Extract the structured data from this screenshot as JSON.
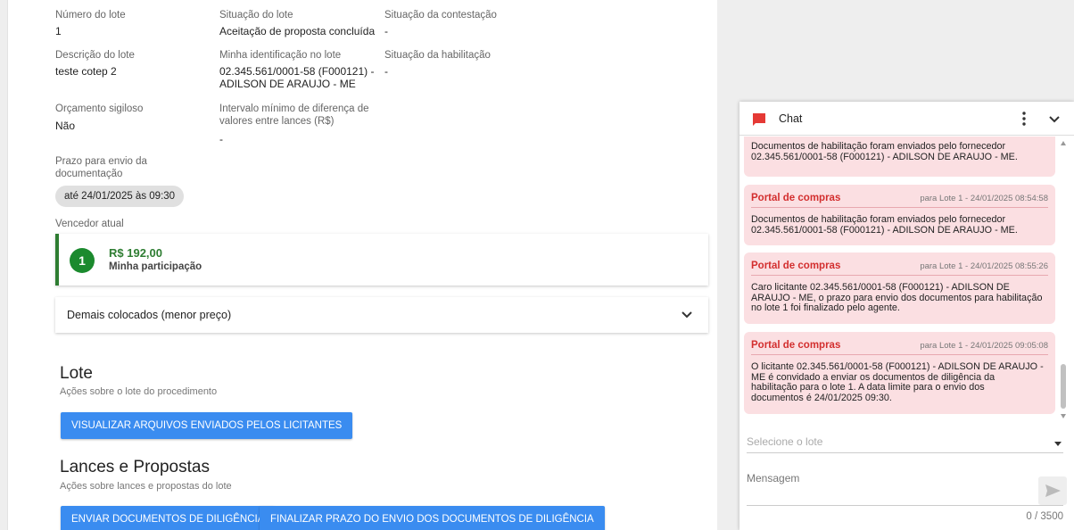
{
  "details": {
    "numero_label": "Número do lote",
    "numero_value": "1",
    "situacao_label": "Situação do lote",
    "situacao_value": "Aceitação de proposta concluída",
    "contestacao_label": "Situação da contestação",
    "contestacao_value": "-",
    "descricao_label": "Descrição do lote",
    "descricao_value": "teste cotep 2",
    "identificacao_label": "Minha identificação no lote",
    "identificacao_line1": "02.345.561/0001-58 (F000121) -",
    "identificacao_line2": "ADILSON DE ARAUJO - ME",
    "habilitacao_label": "Situação da habilitação",
    "habilitacao_value": "-",
    "orcamento_label": "Orçamento sigiloso",
    "orcamento_value": "Não",
    "intervalo_label_line1": "Intervalo mínimo de diferença de",
    "intervalo_label_line2": "valores entre lances (R$)",
    "intervalo_value": "-",
    "prazo_label_line1": "Prazo para envio da",
    "prazo_label_line2": "documentação",
    "prazo_value": "até 24/01/2025 às 09:30",
    "vencedor_label": "Vencedor atual"
  },
  "winner": {
    "position": "1",
    "amount": "R$ 192,00",
    "subtitle": "Minha participação"
  },
  "expander": {
    "label": "Demais colocados (menor preço)"
  },
  "lote_section": {
    "title": "Lote",
    "subtitle": "Ações sobre o lote do procedimento",
    "button": "VISUALIZAR ARQUIVOS ENVIADOS PELOS LICITANTES"
  },
  "lances_section": {
    "title": "Lances e Propostas",
    "subtitle": "Ações sobre lances e propostas do lote",
    "button1": "ENVIAR DOCUMENTOS DE DILIGÊNCIA",
    "button2": "FINALIZAR PRAZO DO ENVIO DOS DOCUMENTOS DE DILIGÊNCIA"
  },
  "chat": {
    "title": "Chat",
    "messages": [
      {
        "lines": [
          "Documentos de habilitação foram enviados pelo fornecedor",
          "02.345.561/0001-58 (F000121) - ADILSON DE ARAUJO - ME."
        ]
      },
      {
        "from": "Portal de compras",
        "meta": "para Lote 1  -  24/01/2025 08:54:58",
        "lines": [
          "Documentos de habilitação foram enviados pelo fornecedor",
          "02.345.561/0001-58 (F000121) - ADILSON DE ARAUJO - ME."
        ]
      },
      {
        "from": "Portal de compras",
        "meta": "para Lote 1  -  24/01/2025 08:55:26",
        "lines": [
          "Caro licitante 02.345.561/0001-58 (F000121) - ADILSON DE",
          "ARAUJO - ME, o prazo para envio dos documentos para habilitação",
          "no lote  1 foi finalizado pelo agente."
        ]
      },
      {
        "from": "Portal de compras",
        "meta": "para Lote 1  -  24/01/2025 09:05:08",
        "lines": [
          "O licitante 02.345.561/0001-58 (F000121) - ADILSON DE ARAUJO -",
          "ME é convidado a enviar os documentos de diligência da",
          "habilitação para o lote   1. A data limite para o envio dos",
          "documentos é 24/01/2025 09:30."
        ]
      }
    ],
    "select_placeholder": "Selecione o lote",
    "message_placeholder": "Mensagem",
    "counter": "0 / 3500"
  },
  "colors": {
    "primary_button": "#3a8cf0",
    "winner_green": "#2e7d32",
    "chat_bubble": "#fbdfe2",
    "chat_sender": "#d32f2f"
  },
  "icons": [
    "chat-flag-icon",
    "more-vert-icon",
    "chevron-down-icon",
    "send-icon"
  ]
}
